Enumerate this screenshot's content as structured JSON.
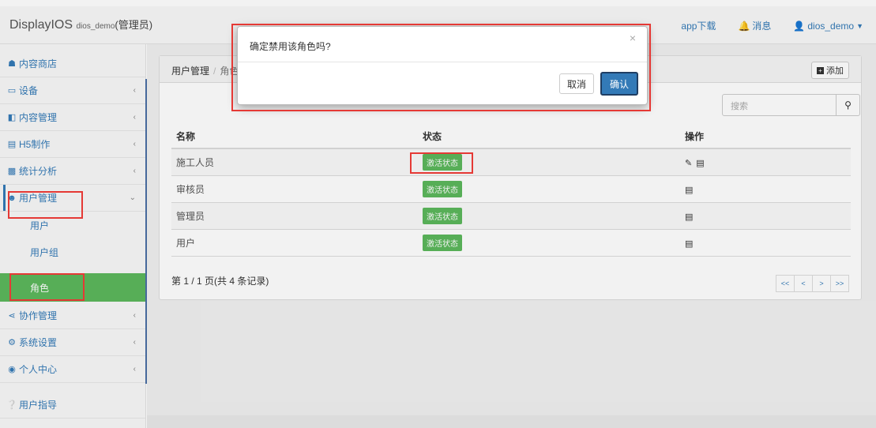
{
  "navbar": {
    "brand": "DisplayIOS",
    "username_small": "dios_demo",
    "role": "(管理员)",
    "app_download": "app下载",
    "messages": "消息",
    "user": "dios_demo"
  },
  "sidebar": {
    "items": [
      {
        "label": "内容商店",
        "icon": "store-icon"
      },
      {
        "label": "设备",
        "icon": "monitor-icon"
      },
      {
        "label": "内容管理",
        "icon": "content-icon"
      },
      {
        "label": "H5制作",
        "icon": "h5-icon"
      },
      {
        "label": "统计分析",
        "icon": "chart-icon"
      },
      {
        "label": "用户管理",
        "icon": "users-icon"
      },
      {
        "label": "用户"
      },
      {
        "label": "用户组"
      },
      {
        "label": "角色"
      },
      {
        "label": "协作管理",
        "icon": "flow-icon"
      },
      {
        "label": "系统设置",
        "icon": "gear-icon"
      },
      {
        "label": "个人中心",
        "icon": "person-icon"
      },
      {
        "label": "用户指导",
        "icon": "help-icon"
      }
    ]
  },
  "breadcrumb": {
    "parent": "用户管理",
    "current": "角色"
  },
  "add_label": "添加",
  "search": {
    "placeholder": "搜索"
  },
  "table": {
    "headers": [
      "名称",
      "状态",
      "操作"
    ],
    "rows": [
      {
        "name": "施工人员",
        "status": "激活状态"
      },
      {
        "name": "审核员",
        "status": "激活状态"
      },
      {
        "name": "管理员",
        "status": "激活状态"
      },
      {
        "name": "用户",
        "status": "激活状态"
      }
    ]
  },
  "pager": {
    "text": "第 1 / 1 页(共 4 条记录)",
    "buttons": [
      "<<",
      "<",
      ">",
      ">>"
    ]
  },
  "modal": {
    "title": "确定禁用该角色吗?",
    "close": "×",
    "cancel": "取消",
    "ok": "确认"
  },
  "colors": {
    "accent": "#337ab7",
    "success": "#5cb85c",
    "highlight": "#e53935"
  }
}
